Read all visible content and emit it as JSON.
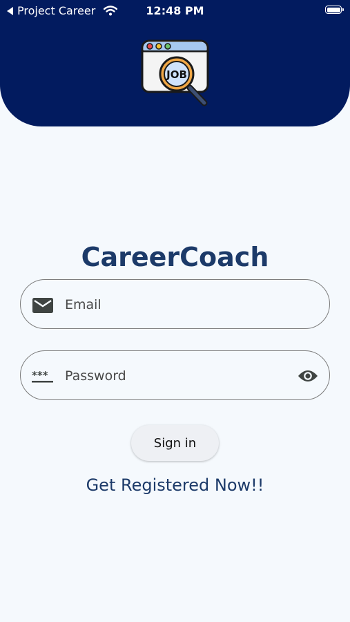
{
  "status_bar": {
    "back_app": "Project Career",
    "time": "12:48 PM"
  },
  "app": {
    "title": "CareerCoach",
    "logo_text": "JOB"
  },
  "form": {
    "email_placeholder": "Email",
    "password_placeholder": "Password",
    "sign_in_label": "Sign in",
    "register_label": "Get Registered Now!!"
  },
  "colors": {
    "header_bg": "#021b5f",
    "page_bg": "#f5f9fd",
    "title": "#1c3a69",
    "field_border": "#7c7c7c"
  },
  "icons": [
    "back-arrow-icon",
    "wifi-icon",
    "battery-icon",
    "mail-icon",
    "password-dots-icon",
    "eye-icon"
  ]
}
